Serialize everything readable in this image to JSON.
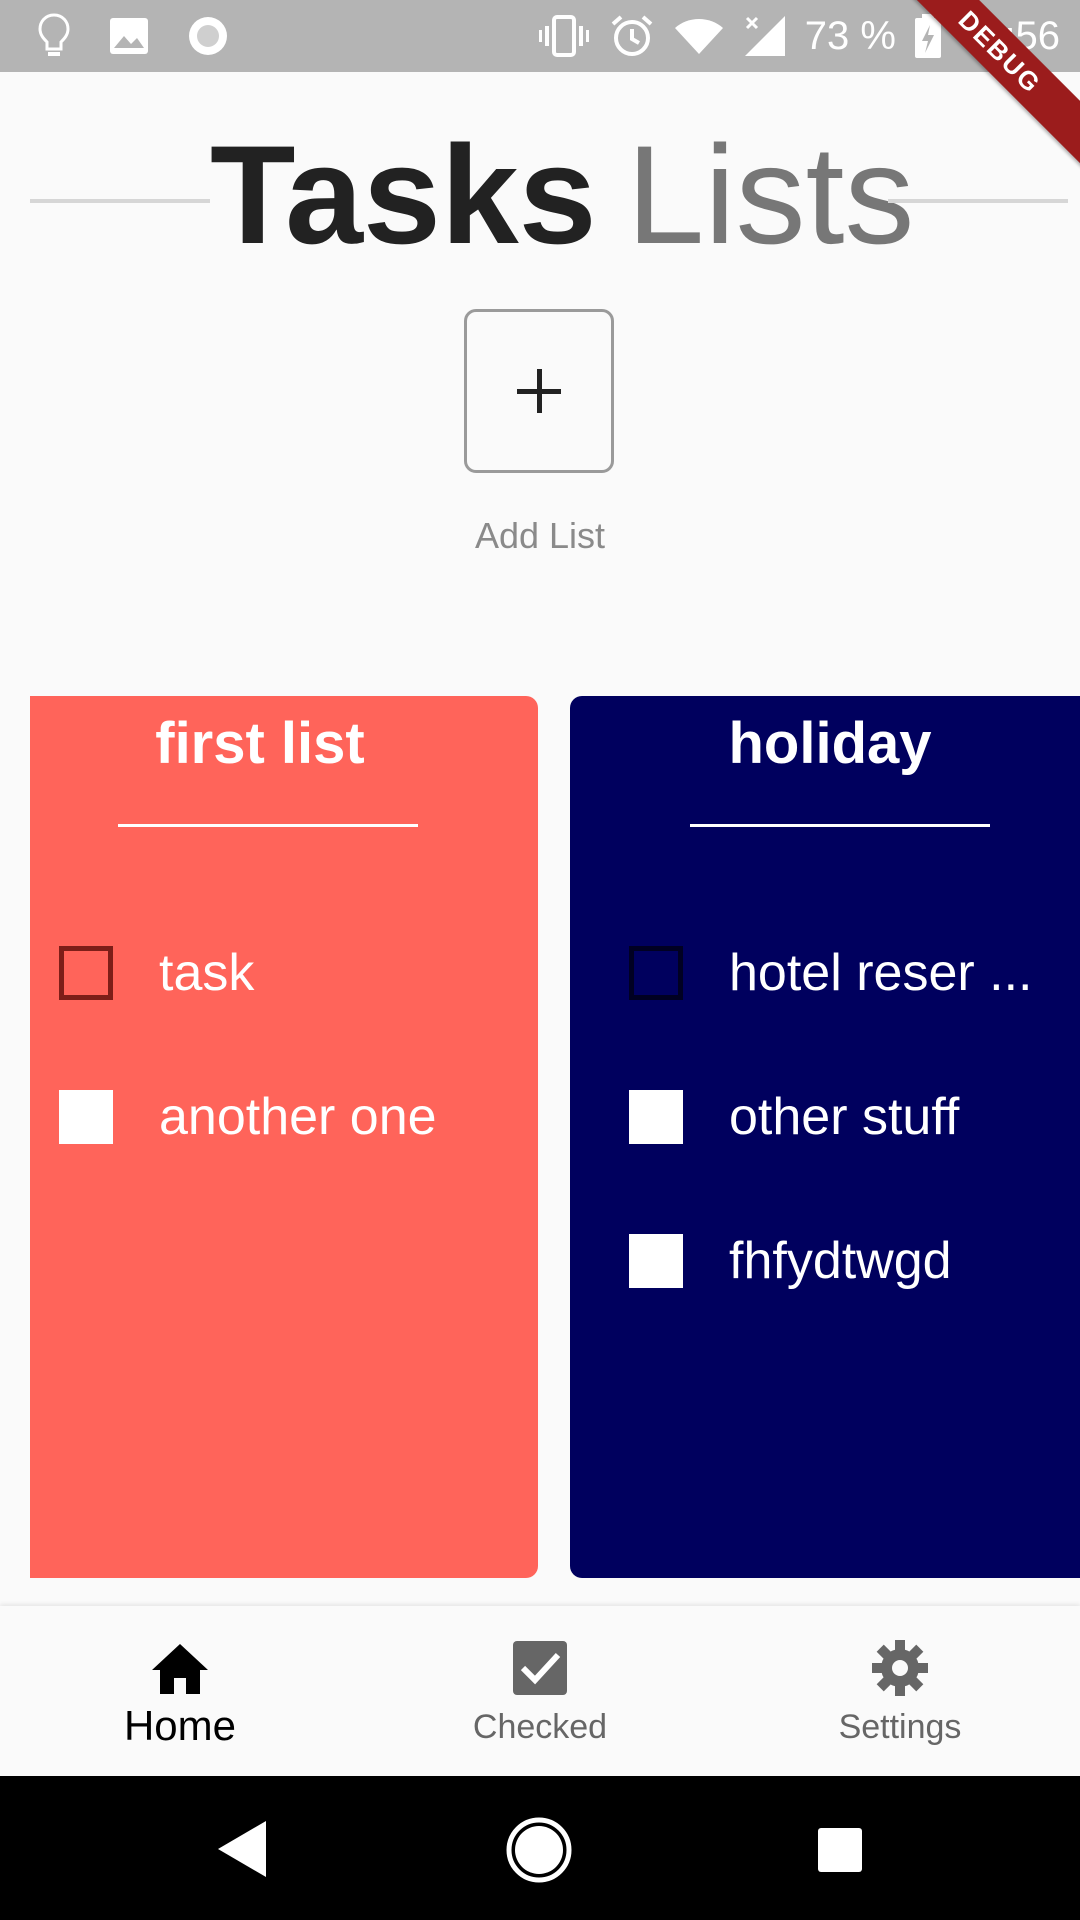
{
  "status_bar": {
    "time": "02:56",
    "battery": "73 %",
    "debug_banner": "DEBUG",
    "icons_left": [
      "lightbulb-icon",
      "image-icon",
      "circle-record-icon"
    ],
    "icons_right": [
      "vibrate-icon",
      "alarm-icon",
      "wifi-icon",
      "signal-icon",
      "battery-charging-icon"
    ]
  },
  "header": {
    "title_bold": "Tasks",
    "title_light": "Lists"
  },
  "add_list": {
    "button_symbol": "+",
    "label": "Add List"
  },
  "lists": [
    {
      "name": "first list",
      "color": "#ff645a",
      "tasks": [
        {
          "label": "task",
          "checked": false
        },
        {
          "label": "another one",
          "checked": true
        }
      ]
    },
    {
      "name": "holiday",
      "color": "#00005e",
      "tasks": [
        {
          "label": "hotel reser ...",
          "checked": false
        },
        {
          "label": "other stuff",
          "checked": true
        },
        {
          "label": "fhfydtwgd",
          "checked": true
        }
      ]
    }
  ],
  "bottom_nav": {
    "items": [
      {
        "label": "Home",
        "icon": "home-icon",
        "active": true
      },
      {
        "label": "Checked",
        "icon": "checkbox-icon",
        "active": false
      },
      {
        "label": "Settings",
        "icon": "gear-icon",
        "active": false
      }
    ]
  },
  "system_nav": {
    "icons": [
      "back-icon",
      "home-circle-icon",
      "recents-icon"
    ]
  }
}
